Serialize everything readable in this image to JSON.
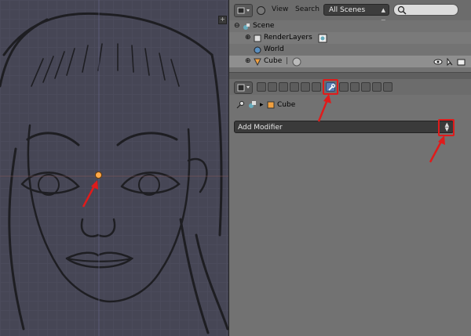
{
  "outliner_header": {
    "view_label": "View",
    "search_label": "Search",
    "scene_filter": "All Scenes"
  },
  "outliner": {
    "rows": [
      {
        "label": "Scene"
      },
      {
        "label": "RenderLayers"
      },
      {
        "label": "World"
      },
      {
        "label": "Cube"
      }
    ]
  },
  "properties": {
    "breadcrumb_object": "Cube",
    "add_modifier_label": "Add Modifier"
  },
  "colors": {
    "highlight": "#e01b1b",
    "viewport_bg": "#464655",
    "panel_bg": "#727272"
  }
}
